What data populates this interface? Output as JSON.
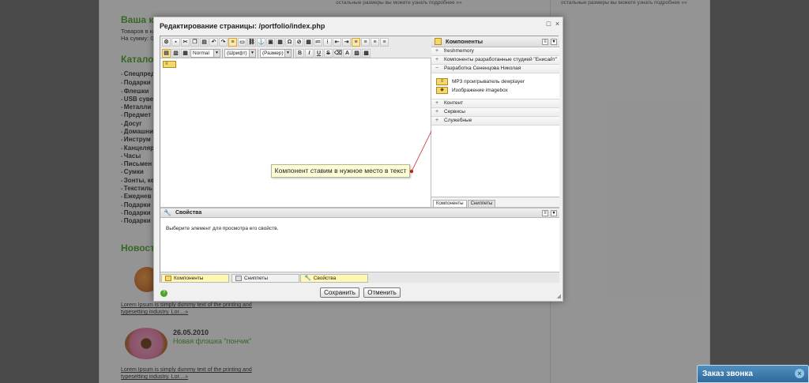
{
  "background": {
    "top_notes": [
      "остальные размеры вы можете узнать подробнее »»",
      "остальные размеры вы можете узнать подробнее »»"
    ],
    "cart_title": "Ваша ко",
    "cart_lines": [
      "Товаров в кор",
      "На сумму: 0"
    ],
    "catalog_title": "Каталог",
    "categories": [
      "Спецпред",
      "Подарки",
      "Флешки",
      "USB суве",
      "Металли",
      "Предмет",
      "Досуг",
      "Домашни",
      "Инструм",
      "Канцеляр",
      "Часы",
      "Письмен",
      "Сумки",
      "Зонты, ке",
      "Текстиль",
      "Ежеднев",
      "Подарки",
      "Подарки",
      "Подарки"
    ],
    "news_title": "Новост",
    "news": [
      {
        "link": "Lorem Ipsum is simply dummy text of the printing and",
        "link2": "typesetting industry. Lor....»"
      },
      {
        "date": "26.05.2010",
        "title": "Новая флэшка \"пончик\"",
        "link": "Lorem Ipsum is simply dummy text of the printing and",
        "link2": "typesetting industry. Lor....»"
      }
    ]
  },
  "dialog": {
    "title": "Редактирование страницы: /portfolio/index.php",
    "toolbar": {
      "style_select": "Normal",
      "font_select": "(Шрифт)",
      "size_select": "(Размер)",
      "bold": "B",
      "italic": "I",
      "underline": "U",
      "strike": "S"
    },
    "callout": "Компонент ставим в нужное место в текст",
    "components_panel": {
      "title": "Компоненты",
      "groups_top": [
        "freshmemory",
        "Компоненты разработанные студией \"Енисайт\"",
        "Разработка Сененцова Николая"
      ],
      "items": [
        "MP3 проигрыватель dewplayer",
        "Изображение imagebox"
      ],
      "groups_bottom": [
        "Контент",
        "Сервисы",
        "Служебные"
      ],
      "tabs": [
        "Компоненты",
        "Сниппеты"
      ]
    },
    "properties": {
      "title": "Свойства",
      "message": "Выберите элемент для просмотра его свойств."
    },
    "bottom_tabs": [
      "Компоненты",
      "Сниппеты",
      "Свойства"
    ],
    "save_label": "Сохранить",
    "cancel_label": "Отменить"
  },
  "call_widget": {
    "label": "Заказ звонка",
    "close": "×"
  }
}
